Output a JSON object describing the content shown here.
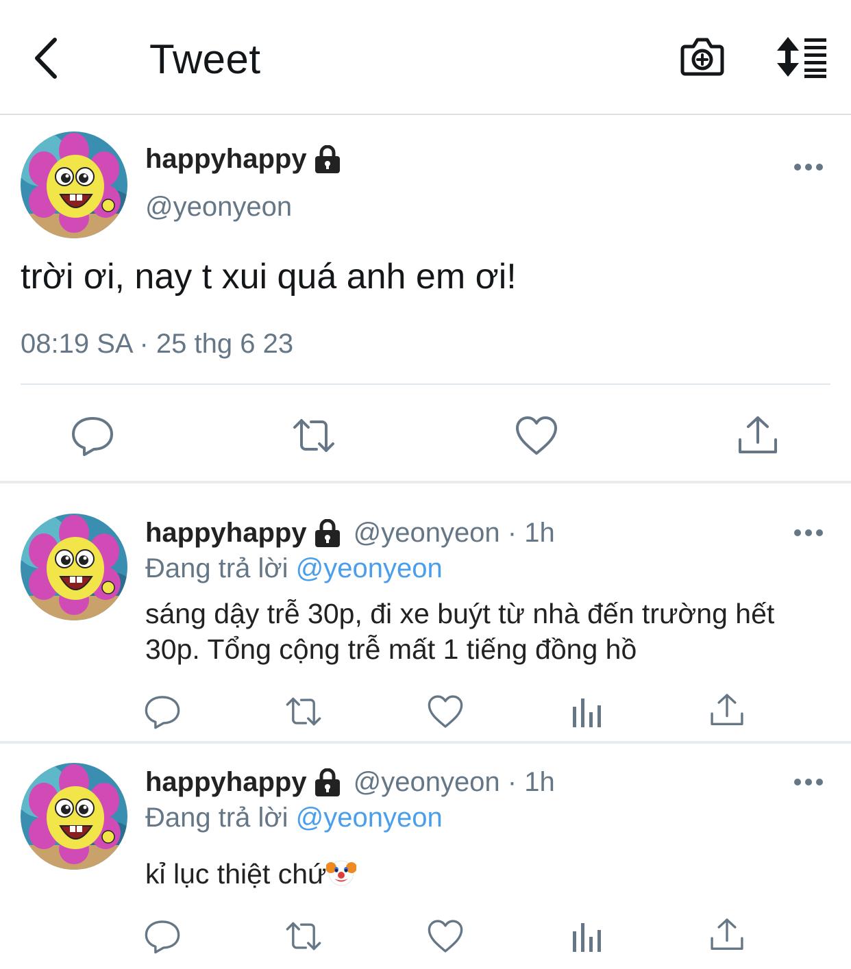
{
  "header": {
    "title": "Tweet",
    "back_icon": "chevron-left-icon",
    "camera_icon": "camera-plus-icon",
    "sort_icon": "sort-list-icon"
  },
  "main_tweet": {
    "display_name": "happyhappy",
    "handle": "@yeonyeon",
    "text": "trời ơi, nay t xui quá anh em ơi!",
    "timestamp": "08:19 SA · 25 thg 6 23",
    "actions": [
      "reply-icon",
      "retweet-icon",
      "like-icon",
      "share-icon"
    ]
  },
  "replies": [
    {
      "display_name": "happyhappy",
      "handle_time": "@yeonyeon · 1h",
      "replying_prefix": "Đang trả lời ",
      "replying_to": "@yeonyeon",
      "text": "sáng dậy trễ 30p, đi xe buýt từ nhà đến trường hết 30p. Tổng cộng trễ mất 1 tiếng đồng hồ",
      "actions": [
        "reply-icon",
        "retweet-icon",
        "like-icon",
        "analytics-icon",
        "share-icon"
      ]
    },
    {
      "display_name": "happyhappy",
      "handle_time": "@yeonyeon · 1h",
      "replying_prefix": "Đang trả lời ",
      "replying_to": "@yeonyeon",
      "text": "kỉ lục thiệt chứ",
      "emoji": "clown-face-emoji",
      "actions": [
        "reply-icon",
        "retweet-icon",
        "like-icon",
        "analytics-icon",
        "share-icon"
      ]
    }
  ],
  "colors": {
    "text": "#14171a",
    "secondary": "#657786",
    "mention": "#4a9eeb",
    "icon": "#657786",
    "divider": "#e1e8ed"
  }
}
